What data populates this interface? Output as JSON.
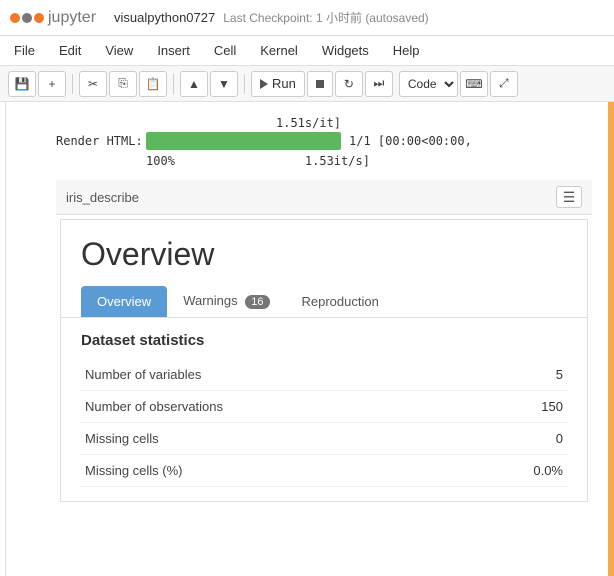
{
  "topbar": {
    "logo_text": "jupyter",
    "notebook_name": "visualpython0727",
    "checkpoint_text": "Last Checkpoint: 1 小时前",
    "autosaved_text": "(autosaved)"
  },
  "menubar": {
    "items": [
      "File",
      "Edit",
      "View",
      "Insert",
      "Cell",
      "Kernel",
      "Widgets",
      "Help"
    ]
  },
  "toolbar": {
    "run_label": "Run",
    "cell_type": "Code"
  },
  "output": {
    "speed_line": "1.51s/it]",
    "render_label": "Render HTML:",
    "progress_value": 100,
    "progress_text": "1/1 [00:00<00:00,",
    "progress_speed": "1.53it/s]",
    "percent_text": "100%"
  },
  "widget": {
    "title": "iris_describe",
    "toggle_symbol": "☰"
  },
  "report": {
    "heading": "Overview",
    "tabs": [
      {
        "label": "Overview",
        "active": true
      },
      {
        "label": "Warnings",
        "badge": "16",
        "active": false
      },
      {
        "label": "Reproduction",
        "active": false
      }
    ],
    "stats_title": "Dataset statistics",
    "stats_rows": [
      {
        "label": "Number of variables",
        "value": "5"
      },
      {
        "label": "Number of observations",
        "value": "150"
      },
      {
        "label": "Missing cells",
        "value": "0"
      },
      {
        "label": "Missing cells (%)",
        "value": "0.0%"
      }
    ]
  }
}
